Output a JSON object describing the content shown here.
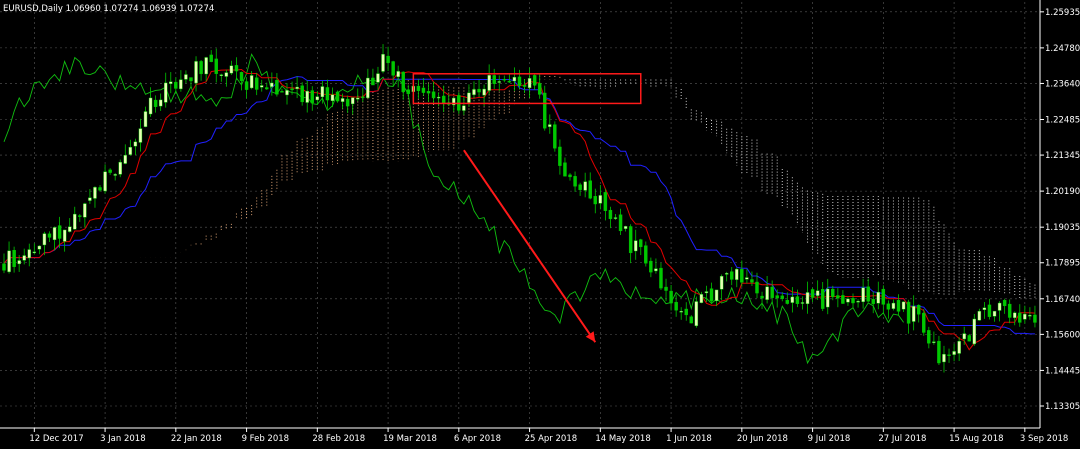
{
  "header": {
    "text": "EURUSD,Daily  1.06960 1.07274 1.06939 1.07274"
  },
  "colors": {
    "background": "#000000",
    "grid": "#5a5a5a",
    "axis": "#ffffff",
    "candle_up": "#e6ffb3",
    "candle_down": "#00c800",
    "tenkan": "#e00000",
    "kijun": "#2020ff",
    "chikou": "#10c010",
    "cloud_bull": "#d7a073",
    "cloud_bear": "#c8c8c8",
    "annotation": "#ff1a1a"
  },
  "chart_data": {
    "type": "line",
    "symbol": "EURUSD",
    "timeframe": "Daily",
    "ohlc_header": {
      "open": 1.0696,
      "high": 1.07274,
      "low": 1.06939,
      "close": 1.07274
    },
    "indicator": "Ichimoku Kinko Hyo (candles, tenkan, kijun, chikou, cloud)",
    "ylim": [
      1.126,
      1.2625
    ],
    "y_ticks": [
      "1.25935",
      "1.24780",
      "1.23640",
      "1.22485",
      "1.21345",
      "1.20190",
      "1.19035",
      "1.17895",
      "1.16740",
      "1.15600",
      "1.14445",
      "1.13305"
    ],
    "x_ticks": [
      "12 Dec 2017",
      "3 Jan 2018",
      "22 Jan 2018",
      "9 Feb 2018",
      "28 Feb 2018",
      "19 Mar 2018",
      "6 Apr 2018",
      "25 Apr 2018",
      "14 May 2018",
      "1 Jun 2018",
      "20 Jun 2018",
      "9 Jul 2018",
      "27 Jul 2018",
      "15 Aug 2018",
      "3 Sep 2018"
    ],
    "grid": true,
    "bar_count": 205,
    "price_path_anchors": [
      [
        0,
        1.1785
      ],
      [
        10,
        1.188
      ],
      [
        20,
        1.205
      ],
      [
        30,
        1.231
      ],
      [
        40,
        1.243
      ],
      [
        50,
        1.235
      ],
      [
        60,
        1.233
      ],
      [
        70,
        1.23
      ],
      [
        75,
        1.243
      ],
      [
        80,
        1.233
      ],
      [
        90,
        1.23
      ],
      [
        95,
        1.236
      ],
      [
        100,
        1.239
      ],
      [
        105,
        1.235
      ],
      [
        110,
        1.21
      ],
      [
        120,
        1.194
      ],
      [
        130,
        1.172
      ],
      [
        135,
        1.16
      ],
      [
        140,
        1.17
      ],
      [
        145,
        1.176
      ],
      [
        150,
        1.169
      ],
      [
        160,
        1.167
      ],
      [
        170,
        1.168
      ],
      [
        180,
        1.162
      ],
      [
        185,
        1.148
      ],
      [
        190,
        1.154
      ],
      [
        195,
        1.165
      ],
      [
        200,
        1.162
      ],
      [
        204,
        1.161
      ]
    ],
    "annotations": [
      {
        "type": "rectangle",
        "bar_from": 81,
        "bar_to": 126,
        "price_high": 1.2395,
        "price_low": 1.23
      },
      {
        "type": "arrow",
        "bar_from": 91,
        "price_from": 1.215,
        "bar_to": 117,
        "price_to": 1.1535
      }
    ]
  }
}
